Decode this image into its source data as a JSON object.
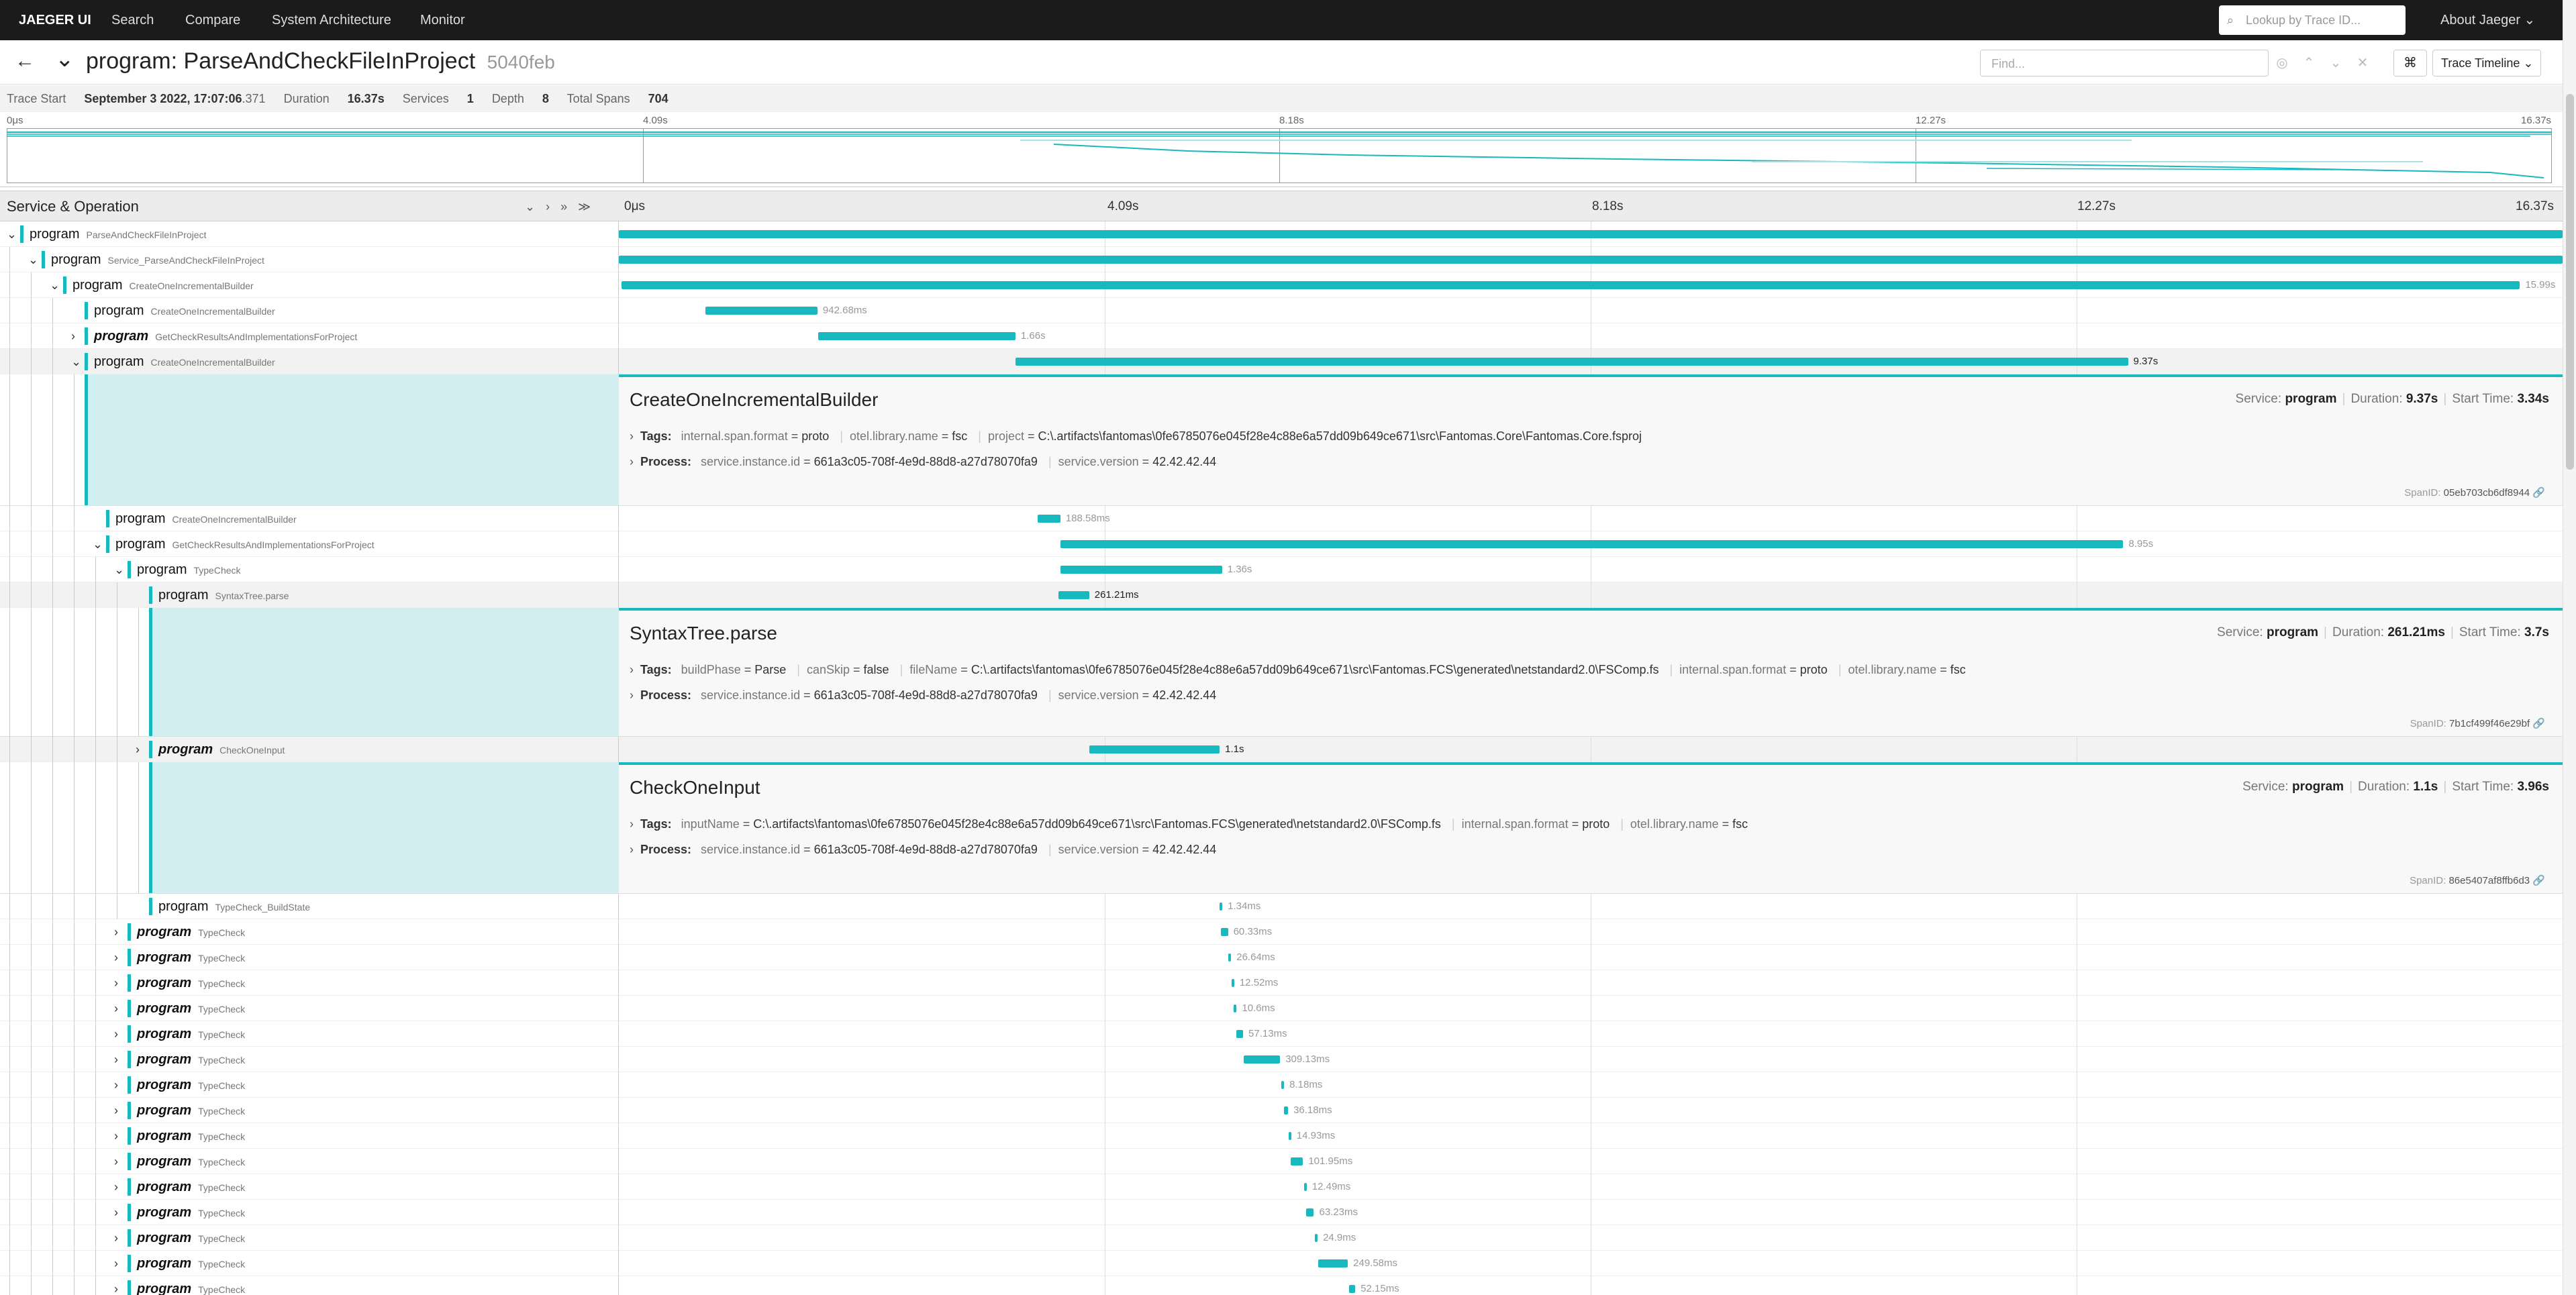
{
  "nav": {
    "brand": "JAEGER UI",
    "items": [
      "Search",
      "Compare",
      "System Architecture",
      "Monitor"
    ],
    "lookup_placeholder": "Lookup by Trace ID...",
    "about": "About Jaeger ⌄"
  },
  "trace": {
    "service": "program:",
    "operation": "ParseAndCheckFileInProject",
    "trace_id": "5040feb",
    "find_placeholder": "Find...",
    "view_mode": "Trace Timeline ⌄"
  },
  "meta": {
    "start_label": "Trace Start",
    "start_value": "September 3 2022, 17:07:06",
    "start_ms": ".371",
    "duration_label": "Duration",
    "duration_value": "16.37s",
    "services_label": "Services",
    "services_value": "1",
    "depth_label": "Depth",
    "depth_value": "8",
    "spans_label": "Total Spans",
    "spans_value": "704"
  },
  "minimap_ticks": [
    "0μs",
    "4.09s",
    "8.18s",
    "12.27s",
    "16.37s"
  ],
  "timeline": {
    "column_title": "Service & Operation",
    "ticks": [
      "0μs",
      "4.09s",
      "8.18s",
      "12.27s",
      "16.37s"
    ],
    "total_seconds": 16.37,
    "spans": [
      {
        "depth": 0,
        "caret": "⌄",
        "service": "program",
        "operation": "ParseAndCheckFileInProject",
        "start": 0,
        "dur": 16.37,
        "label": ""
      },
      {
        "depth": 1,
        "caret": "⌄",
        "service": "program",
        "operation": "Service_ParseAndCheckFileInProject",
        "start": 0,
        "dur": 16.37,
        "label": ""
      },
      {
        "depth": 2,
        "caret": "⌄",
        "service": "program",
        "operation": "CreateOneIncrementalBuilder",
        "start": 0.02,
        "dur": 15.99,
        "label": "15.99s"
      },
      {
        "depth": 3,
        "caret": "",
        "service": "program",
        "operation": "CreateOneIncrementalBuilder",
        "start": 0.73,
        "dur": 0.94268,
        "label": "942.68ms"
      },
      {
        "depth": 3,
        "caret": "›",
        "service": "program",
        "operation": "GetCheckResultsAndImplementationsForProject",
        "start": 1.68,
        "dur": 1.66,
        "label": "1.66s",
        "bold": true
      },
      {
        "depth": 3,
        "caret": "⌄",
        "service": "program",
        "operation": "CreateOneIncrementalBuilder",
        "start": 3.34,
        "dur": 9.37,
        "label": "9.37s",
        "dark": true,
        "selected": true,
        "detail": {
          "title": "CreateOneIncrementalBuilder",
          "service": "program",
          "duration": "9.37s",
          "start_time": "3.34s",
          "tags": [
            [
              "internal.span.format",
              "proto"
            ],
            [
              "otel.library.name",
              "fsc"
            ],
            [
              "project",
              "C:\\.artifacts\\fantomas\\0fe6785076e045f28e4c88e6a57dd09b649ce671\\src\\Fantomas.Core\\Fantomas.Core.fsproj"
            ]
          ],
          "process": [
            [
              "service.instance.id",
              "661a3c05-708f-4e9d-88d8-a27d78070fa9"
            ],
            [
              "service.version",
              "42.42.42.44"
            ]
          ],
          "span_id": "05eb703cb6df8944",
          "height": 196
        }
      },
      {
        "depth": 4,
        "caret": "",
        "service": "program",
        "operation": "CreateOneIncrementalBuilder",
        "start": 3.53,
        "dur": 0.18858,
        "label": "188.58ms"
      },
      {
        "depth": 4,
        "caret": "⌄",
        "service": "program",
        "operation": "GetCheckResultsAndImplementationsForProject",
        "start": 3.72,
        "dur": 8.95,
        "label": "8.95s"
      },
      {
        "depth": 5,
        "caret": "⌄",
        "service": "program",
        "operation": "TypeCheck",
        "start": 3.72,
        "dur": 1.36,
        "label": "1.36s"
      },
      {
        "depth": 6,
        "caret": "",
        "service": "program",
        "operation": "SyntaxTree.parse",
        "start": 3.7,
        "dur": 0.26121,
        "label": "261.21ms",
        "dark": true,
        "selected": true,
        "detail": {
          "title": "SyntaxTree.parse",
          "service": "program",
          "duration": "261.21ms",
          "start_time": "3.7s",
          "tags": [
            [
              "buildPhase",
              "Parse"
            ],
            [
              "canSkip",
              "false"
            ],
            [
              "fileName",
              "C:\\.artifacts\\fantomas\\0fe6785076e045f28e4c88e6a57dd09b649ce671\\src\\Fantomas.FCS\\generated\\netstandard2.0\\FSComp.fs"
            ],
            [
              "internal.span.format",
              "proto"
            ],
            [
              "otel.library.name",
              "fsc"
            ]
          ],
          "process": [
            [
              "service.instance.id",
              "661a3c05-708f-4e9d-88d8-a27d78070fa9"
            ],
            [
              "service.version",
              "42.42.42.44"
            ]
          ],
          "span_id": "7b1cf499f46e29bf",
          "height": 192
        }
      },
      {
        "depth": 6,
        "caret": "›",
        "service": "program",
        "operation": "CheckOneInput",
        "start": 3.96,
        "dur": 1.1,
        "label": "1.1s",
        "bold": true,
        "dark": true,
        "selected": true,
        "detail": {
          "title": "CheckOneInput",
          "service": "program",
          "duration": "1.1s",
          "start_time": "3.96s",
          "tags": [
            [
              "inputName",
              "C:\\.artifacts\\fantomas\\0fe6785076e045f28e4c88e6a57dd09b649ce671\\src\\Fantomas.FCS\\generated\\netstandard2.0\\FSComp.fs"
            ],
            [
              "internal.span.format",
              "proto"
            ],
            [
              "otel.library.name",
              "fsc"
            ]
          ],
          "process": [
            [
              "service.instance.id",
              "661a3c05-708f-4e9d-88d8-a27d78070fa9"
            ],
            [
              "service.version",
              "42.42.42.44"
            ]
          ],
          "span_id": "86e5407af8ffb6d3",
          "height": 196
        }
      },
      {
        "depth": 6,
        "caret": "",
        "service": "program",
        "operation": "TypeCheck_BuildState",
        "start": 5.06,
        "dur": 0.00134,
        "label": "1.34ms"
      },
      {
        "depth": 5,
        "caret": "›",
        "service": "program",
        "operation": "TypeCheck",
        "start": 5.07,
        "dur": 0.06033,
        "label": "60.33ms",
        "bold": true
      },
      {
        "depth": 5,
        "caret": "›",
        "service": "program",
        "operation": "TypeCheck",
        "start": 5.13,
        "dur": 0.02664,
        "label": "26.64ms",
        "bold": true
      },
      {
        "depth": 5,
        "caret": "›",
        "service": "program",
        "operation": "TypeCheck",
        "start": 5.16,
        "dur": 0.01252,
        "label": "12.52ms",
        "bold": true
      },
      {
        "depth": 5,
        "caret": "›",
        "service": "program",
        "operation": "TypeCheck",
        "start": 5.18,
        "dur": 0.0106,
        "label": "10.6ms",
        "bold": true
      },
      {
        "depth": 5,
        "caret": "›",
        "service": "program",
        "operation": "TypeCheck",
        "start": 5.2,
        "dur": 0.05713,
        "label": "57.13ms",
        "bold": true
      },
      {
        "depth": 5,
        "caret": "›",
        "service": "program",
        "operation": "TypeCheck",
        "start": 5.26,
        "dur": 0.30913,
        "label": "309.13ms",
        "bold": true
      },
      {
        "depth": 5,
        "caret": "›",
        "service": "program",
        "operation": "TypeCheck",
        "start": 5.58,
        "dur": 0.00818,
        "label": "8.18ms",
        "bold": true
      },
      {
        "depth": 5,
        "caret": "›",
        "service": "program",
        "operation": "TypeCheck",
        "start": 5.6,
        "dur": 0.03618,
        "label": "36.18ms",
        "bold": true
      },
      {
        "depth": 5,
        "caret": "›",
        "service": "program",
        "operation": "TypeCheck",
        "start": 5.64,
        "dur": 0.01493,
        "label": "14.93ms",
        "bold": true
      },
      {
        "depth": 5,
        "caret": "›",
        "service": "program",
        "operation": "TypeCheck",
        "start": 5.66,
        "dur": 0.10195,
        "label": "101.95ms",
        "bold": true
      },
      {
        "depth": 5,
        "caret": "›",
        "service": "program",
        "operation": "TypeCheck",
        "start": 5.77,
        "dur": 0.01249,
        "label": "12.49ms",
        "bold": true
      },
      {
        "depth": 5,
        "caret": "›",
        "service": "program",
        "operation": "TypeCheck",
        "start": 5.79,
        "dur": 0.06323,
        "label": "63.23ms",
        "bold": true
      },
      {
        "depth": 5,
        "caret": "›",
        "service": "program",
        "operation": "TypeCheck",
        "start": 5.86,
        "dur": 0.0249,
        "label": "24.9ms",
        "bold": true
      },
      {
        "depth": 5,
        "caret": "›",
        "service": "program",
        "operation": "TypeCheck",
        "start": 5.89,
        "dur": 0.24958,
        "label": "249.58ms",
        "bold": true
      },
      {
        "depth": 5,
        "caret": "›",
        "service": "program",
        "operation": "TypeCheck",
        "start": 6.15,
        "dur": 0.05215,
        "label": "52.15ms",
        "bold": true
      }
    ]
  },
  "colors": {
    "accent": "#17b8be",
    "nav_bg": "#1b1b1b"
  }
}
